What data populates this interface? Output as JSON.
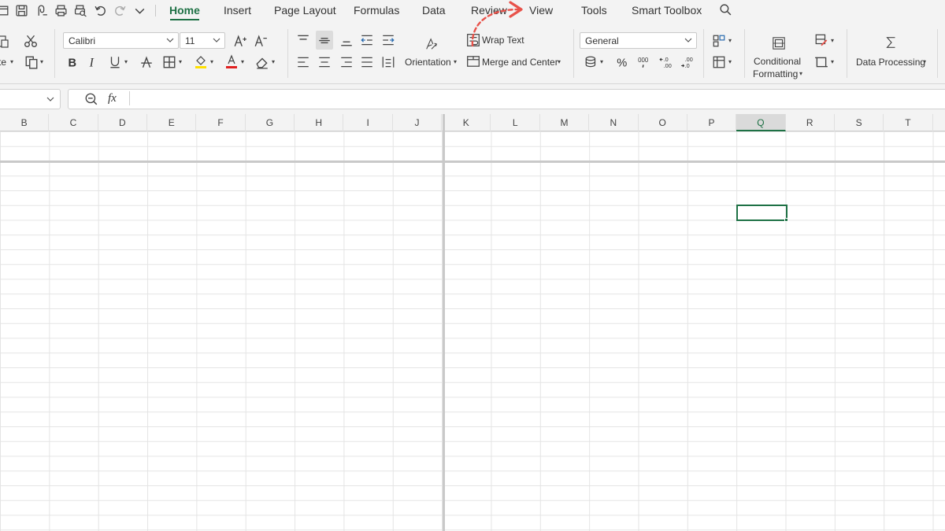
{
  "menu": {
    "tabs": [
      {
        "label": "Home",
        "active": true
      },
      {
        "label": "Insert"
      },
      {
        "label": "Page Layout"
      },
      {
        "label": "Formulas"
      },
      {
        "label": "Data"
      },
      {
        "label": "Review"
      },
      {
        "label": "View"
      },
      {
        "label": "Tools"
      },
      {
        "label": "Smart Toolbox"
      }
    ],
    "quick_access_icons": [
      "file-icon",
      "save-icon",
      "export-icon",
      "print-icon",
      "print-preview-icon",
      "undo-icon",
      "redo-icon",
      "customize-chevron-icon"
    ],
    "search_icon": "search-icon"
  },
  "ribbon": {
    "clipboard": {
      "paste_label": "te"
    },
    "font": {
      "name": "Calibri",
      "size": "11"
    },
    "alignment": {
      "orientation_label": "Orientation",
      "wrap_text_label": "Wrap Text",
      "merge_label": "Merge and Center"
    },
    "number": {
      "format": "General"
    },
    "styles": {
      "conditional_label_1": "Conditional",
      "conditional_label_2": "Formatting"
    },
    "data_processing_label": "Data Processing"
  },
  "formula_bar": {
    "fx_label": "fx",
    "value": ""
  },
  "grid": {
    "columns": [
      "B",
      "C",
      "D",
      "E",
      "F",
      "G",
      "H",
      "I",
      "J",
      "K",
      "L",
      "M",
      "N",
      "O",
      "P",
      "Q",
      "R",
      "S",
      "T"
    ],
    "selected_column": "Q"
  },
  "colors": {
    "accent": "#1e7145",
    "annotation": "#e8524a",
    "font_color_bar": "#e02020",
    "fill_color_bar": "#ffe000"
  }
}
